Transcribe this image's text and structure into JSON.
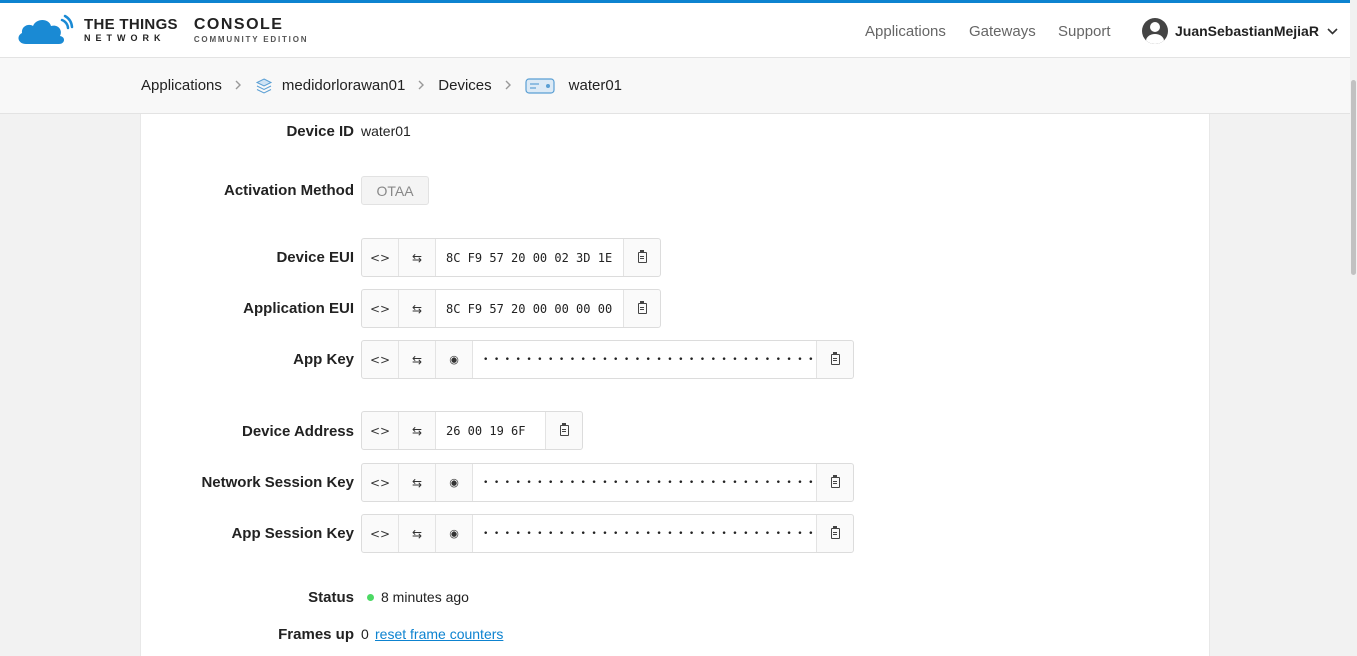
{
  "header": {
    "brand_line1": "THE THINGS",
    "brand_line2": "NETWORK",
    "console_title": "CONSOLE",
    "console_subtitle": "COMMUNITY EDITION",
    "nav": [
      "Applications",
      "Gateways",
      "Support"
    ],
    "user_name": "JuanSebastianMejiaR"
  },
  "breadcrumb": {
    "items": [
      "Applications",
      "medidorlorawan01",
      "Devices",
      "water01"
    ]
  },
  "device": {
    "device_id_label": "Device ID",
    "device_id": "water01",
    "activation_label": "Activation Method",
    "activation": "OTAA",
    "device_eui_label": "Device EUI",
    "device_eui": "8C F9 57 20 00 02 3D 1E",
    "app_eui_label": "Application EUI",
    "app_eui": "8C F9 57 20 00 00 00 00",
    "app_key_label": "App Key",
    "app_key": "• • • • • • • • • • • • • • • • • • • • • • • • • • • • • • •",
    "dev_addr_label": "Device Address",
    "dev_addr": "26 00 19 6F",
    "nwk_skey_label": "Network Session Key",
    "nwk_skey": "• • • • • • • • • • • • • • • • • • • • • • • • • • • • • • •",
    "app_skey_label": "App Session Key",
    "app_skey": "• • • • • • • • • • • • • • • • • • • • • • • • • • • • • • •",
    "status_label": "Status",
    "status": "8 minutes ago",
    "frames_up_label": "Frames up",
    "frames_up": "0",
    "reset_link": "reset frame counters"
  },
  "icons": {
    "code": "<>",
    "swap": "⇆",
    "eye": "👁"
  },
  "colors": {
    "accent": "#0d83d0",
    "status_online": "#4cd964"
  }
}
